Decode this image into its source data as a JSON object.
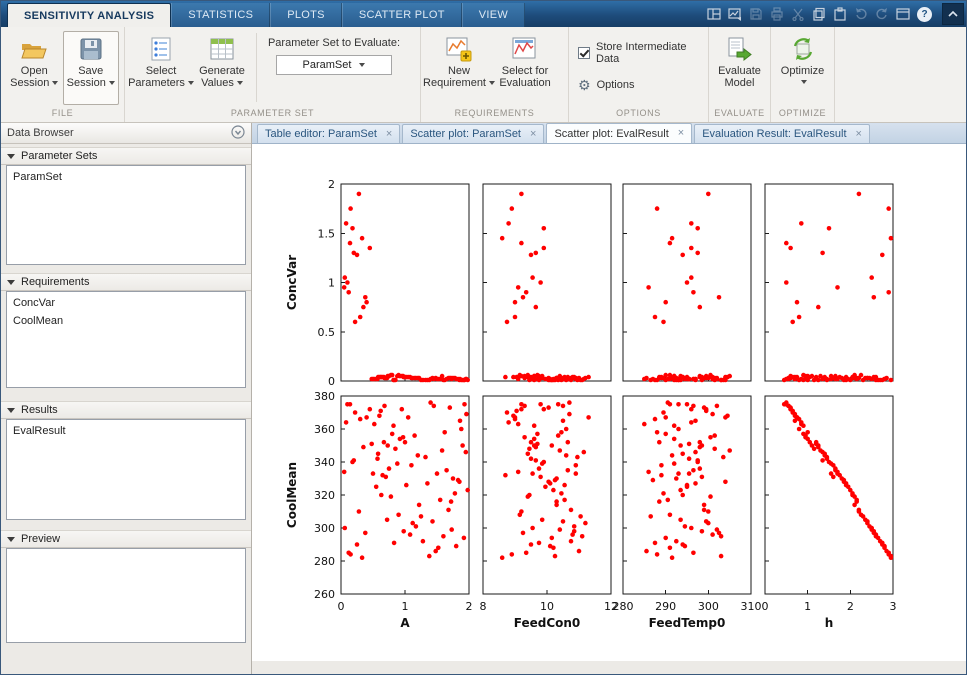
{
  "toolstrip": {
    "tabs": [
      {
        "label": "SENSITIVITY ANALYSIS"
      },
      {
        "label": "STATISTICS"
      },
      {
        "label": "PLOTS"
      },
      {
        "label": "SCATTER PLOT"
      },
      {
        "label": "VIEW"
      }
    ],
    "help_label": "?"
  },
  "ribbon": {
    "groups": {
      "file": {
        "label": "FILE"
      },
      "parameter_set": {
        "label": "PARAMETER SET"
      },
      "requirements": {
        "label": "REQUIREMENTS"
      },
      "options": {
        "label": "OPTIONS"
      },
      "evaluate": {
        "label": "EVALUATE"
      },
      "optimize": {
        "label": "OPTIMIZE"
      }
    },
    "buttons": {
      "open_session": {
        "line1": "Open",
        "line2": "Session"
      },
      "save_session": {
        "line1": "Save",
        "line2": "Session"
      },
      "select_parameters": {
        "line1": "Select",
        "line2": "Parameters"
      },
      "generate_values": {
        "line1": "Generate",
        "line2": "Values"
      },
      "new_requirement": {
        "line1": "New",
        "line2": "Requirement"
      },
      "select_for_evaluation": {
        "line1": "Select for",
        "line2": "Evaluation"
      },
      "evaluate_model": {
        "line1": "Evaluate",
        "line2": "Model"
      },
      "optimize": {
        "line1": "Optimize"
      }
    },
    "param_set_evaluate": {
      "label": "Parameter Set to Evaluate:",
      "value": "ParamSet"
    },
    "options": {
      "store_intermediate": "Store Intermediate Data",
      "options_label": "Options"
    }
  },
  "data_browser": {
    "title": "Data Browser",
    "sections": [
      {
        "title": "Parameter Sets",
        "items": [
          "ParamSet"
        ]
      },
      {
        "title": "Requirements",
        "items": [
          "ConcVar",
          "CoolMean"
        ]
      },
      {
        "title": "Results",
        "items": [
          "EvalResult"
        ]
      },
      {
        "title": "Preview",
        "items": []
      }
    ]
  },
  "documents": {
    "tabs": [
      {
        "label": "Table editor:  ParamSet"
      },
      {
        "label": "Scatter plot:  ParamSet"
      },
      {
        "label": "Scatter plot:  EvalResult"
      },
      {
        "label": "Evaluation Result:  EvalResult"
      }
    ],
    "close_glyph": "×"
  },
  "colors": {
    "toolstrip_blue": "#1e4c7b",
    "marker_red": "#ff0000"
  },
  "chart_data": {
    "type": "scatter",
    "layout": "matrix-2x4",
    "marker_color": "#ff0000",
    "grid": false,
    "rows": [
      {
        "key": "ConcVar",
        "label": "ConcVar",
        "ylim": [
          0,
          2
        ],
        "yticks": [
          0,
          0.5,
          1,
          1.5,
          2
        ]
      },
      {
        "key": "CoolMean",
        "label": "CoolMean",
        "ylim": [
          260,
          380
        ],
        "yticks": [
          260,
          280,
          300,
          320,
          340,
          360,
          380
        ]
      }
    ],
    "cols": [
      {
        "key": "A",
        "label": "A",
        "xlim": [
          0,
          2
        ],
        "xticks": [
          0,
          1,
          2
        ]
      },
      {
        "key": "FeedCon0",
        "label": "FeedCon0",
        "xlim": [
          8,
          12
        ],
        "xticks": [
          8,
          10,
          12
        ]
      },
      {
        "key": "FeedTemp0",
        "label": "FeedTemp0",
        "xlim": [
          280,
          310
        ],
        "xticks": [
          280,
          290,
          300,
          310
        ]
      },
      {
        "key": "h",
        "label": "h",
        "xlim": [
          0,
          3
        ],
        "xticks": [
          0,
          1,
          2,
          3
        ]
      }
    ],
    "samples": {
      "A": [
        0.1,
        1.52,
        0.67,
        1.88,
        0.28,
        1.1,
        0.45,
        1.73,
        0.92,
        1.35,
        0.15,
        1.96,
        0.58,
        1.22,
        0.8,
        1.6,
        0.05,
        1.45,
        0.72,
        1.9,
        0.33,
        1.05,
        0.5,
        1.78,
        0.97,
        1.28,
        0.2,
        1.83,
        0.62,
        1.17,
        0.85,
        1.55,
        0.08,
        1.48,
        0.75,
        1.93,
        0.38,
        1.0,
        0.55,
        1.7,
        0.9,
        1.32,
        0.25,
        1.86,
        0.65,
        1.12,
        0.82,
        1.58,
        0.12,
        1.4,
        0.7,
        1.98,
        0.3,
        1.08,
        0.48,
        1.75,
        0.95,
        1.25,
        0.18,
        1.8,
        0.6,
        1.2,
        0.78,
        1.62,
        0.06,
        1.5,
        0.68,
        1.92,
        0.35,
        1.02,
        0.52,
        1.68,
        0.88,
        1.38,
        0.22,
        1.95,
        0.63,
        1.15,
        0.83,
        1.65,
        0.14,
        1.43,
        0.73,
        1.85,
        0.4,
        0.98,
        0.57,
        1.72
      ],
      "FeedCon0": [
        9.8,
        10.2,
        9.5,
        10.6,
        9.2,
        10.9,
        9.9,
        10.4,
        9.6,
        10.1,
        8.9,
        10.7,
        9.4,
        10.3,
        9.7,
        11.1,
        9.1,
        10.5,
        9.85,
        10.15,
        8.6,
        11.3,
        9.55,
        10.45,
        9.3,
        10.75,
        9.65,
        10.25,
        9.05,
        10.85,
        9.45,
        10.55,
        8.8,
        11.0,
        9.75,
        10.35,
        9.25,
        10.65,
        9.95,
        10.05,
        9.15,
        10.95,
        9.5,
        10.5,
        8.7,
        11.2,
        9.6,
        10.4,
        9.35,
        10.7,
        9.8,
        10.2,
        9.0,
        10.8,
        9.7,
        10.3,
        9.2,
        11.05,
        9.9,
        10.1,
        8.95,
        10.6,
        9.4,
        10.45,
        9.55,
        10.9,
        9.3,
        10.15,
        9.65,
        10.55,
        9.1,
        10.75,
        9.85,
        10.25,
        8.75,
        11.15,
        9.45,
        10.35,
        9.75,
        10.65,
        9.2,
        10.5,
        9.6,
        10.05,
        9.0,
        10.85,
        9.5,
        10.3
      ],
      "FeedTemp0": [
        295,
        291,
        298,
        293,
        300,
        289,
        296,
        302,
        292,
        297,
        288,
        301,
        294,
        299,
        290,
        303,
        286,
        296.5,
        293.5,
        298.5,
        291.5,
        304,
        295.5,
        289.5,
        300.5,
        292.5,
        297.5,
        287,
        299.5,
        294.5,
        301.5,
        290.5,
        296,
        285.5,
        298,
        293,
        302.5,
        288.5,
        295,
        299,
        291,
        303.5,
        294,
        297,
        289,
        300,
        292,
        305,
        296.5,
        290.5,
        298.5,
        293.5,
        287.5,
        301,
        295.5,
        292.5,
        299.5,
        286.5,
        297.5,
        294.5,
        304.5,
        291.5,
        300.5,
        288,
        296,
        293,
        302,
        290,
        298,
        295,
        285,
        299,
        292,
        303,
        289.5,
        297,
        294,
        301.5,
        287.5,
        296.5,
        291,
        299.5,
        293.5,
        304,
        290,
        298.5,
        295.5,
        288.5
      ],
      "h": [
        0.5,
        2.8,
        1.2,
        0.8,
        2.2,
        1.6,
        0.6,
        2.5,
        1.0,
        1.9,
        2.9,
        0.7,
        1.4,
        2.1,
        0.9,
        2.6,
        1.7,
        0.55,
        2.35,
        1.25,
        2.95,
        0.75,
        1.55,
        2.05,
        0.95,
        2.7,
        1.35,
        1.85,
        0.65,
        2.45,
        1.15,
        2.15,
        0.85,
        2.85,
        1.65,
        0.45,
        2.55,
        1.05,
        1.95,
        0.6,
        2.25,
        1.45,
        2.75,
        0.7,
        1.75,
        2.4,
        0.9,
        1.3,
        2.9,
        0.5,
        1.6,
        2.0,
        0.8,
        2.6,
        1.2,
        1.8,
        0.6,
        2.3,
        1.5,
        2.8,
        0.7,
        1.4,
        2.1,
        1.0,
        2.5,
        1.7,
        0.55,
        2.65,
        1.25,
        1.9,
        0.85,
        2.2,
        1.55,
        2.95,
        0.65,
        1.35,
        2.05,
        0.95,
        2.75,
        1.65,
        0.5,
        2.4,
        1.1,
        1.85,
        0.75,
        2.55,
        1.45,
        2.15
      ],
      "ConcVar": [
        1.0,
        0.02,
        0.04,
        0.01,
        1.9,
        0.03,
        1.35,
        0.02,
        0.05,
        0.01,
        1.75,
        0.02,
        0.04,
        0.03,
        0.06,
        0.01,
        0.95,
        0.02,
        0.03,
        0.01,
        1.45,
        0.04,
        0.02,
        0.03,
        0.05,
        0.01,
        1.3,
        0.02,
        0.04,
        0.03,
        0.01,
        0.02,
        1.6,
        0.03,
        0.05,
        0.01,
        0.85,
        0.04,
        0.02,
        0.03,
        0.06,
        0.01,
        1.28,
        0.02,
        0.04,
        0.03,
        0.01,
        0.05,
        0.9,
        0.02,
        0.03,
        0.01,
        0.65,
        0.04,
        0.02,
        0.03,
        0.05,
        0.01,
        1.55,
        0.02,
        0.04,
        0.03,
        0.06,
        0.01,
        1.05,
        0.02,
        0.03,
        0.01,
        0.75,
        0.04,
        0.02,
        0.03,
        0.05,
        0.01,
        0.6,
        0.02,
        0.04,
        0.03,
        0.01,
        0.02,
        1.4,
        0.03,
        0.05,
        0.01,
        0.8,
        0.04,
        0.02,
        0.03
      ],
      "CoolMean": [
        375,
        288,
        352,
        360,
        310,
        338,
        372,
        299,
        354,
        327,
        284,
        369,
        345,
        314,
        357,
        295,
        334,
        374,
        305,
        350,
        282,
        367,
        333,
        321,
        355,
        292,
        341,
        329,
        371,
        301,
        348,
        317,
        364,
        286,
        336,
        375,
        297,
        352,
        325,
        373,
        308,
        343,
        290,
        365,
        332,
        303,
        362,
        347,
        285,
        376,
        331,
        323,
        366,
        296,
        351,
        330,
        372,
        307,
        340,
        289,
        368,
        344,
        319,
        358,
        300,
        333,
        374,
        294,
        349,
        326,
        363,
        311,
        339,
        283,
        370,
        346,
        320,
        356,
        291,
        335,
        375,
        304,
        350,
        328,
        367,
        298,
        342,
        316
      ]
    }
  }
}
